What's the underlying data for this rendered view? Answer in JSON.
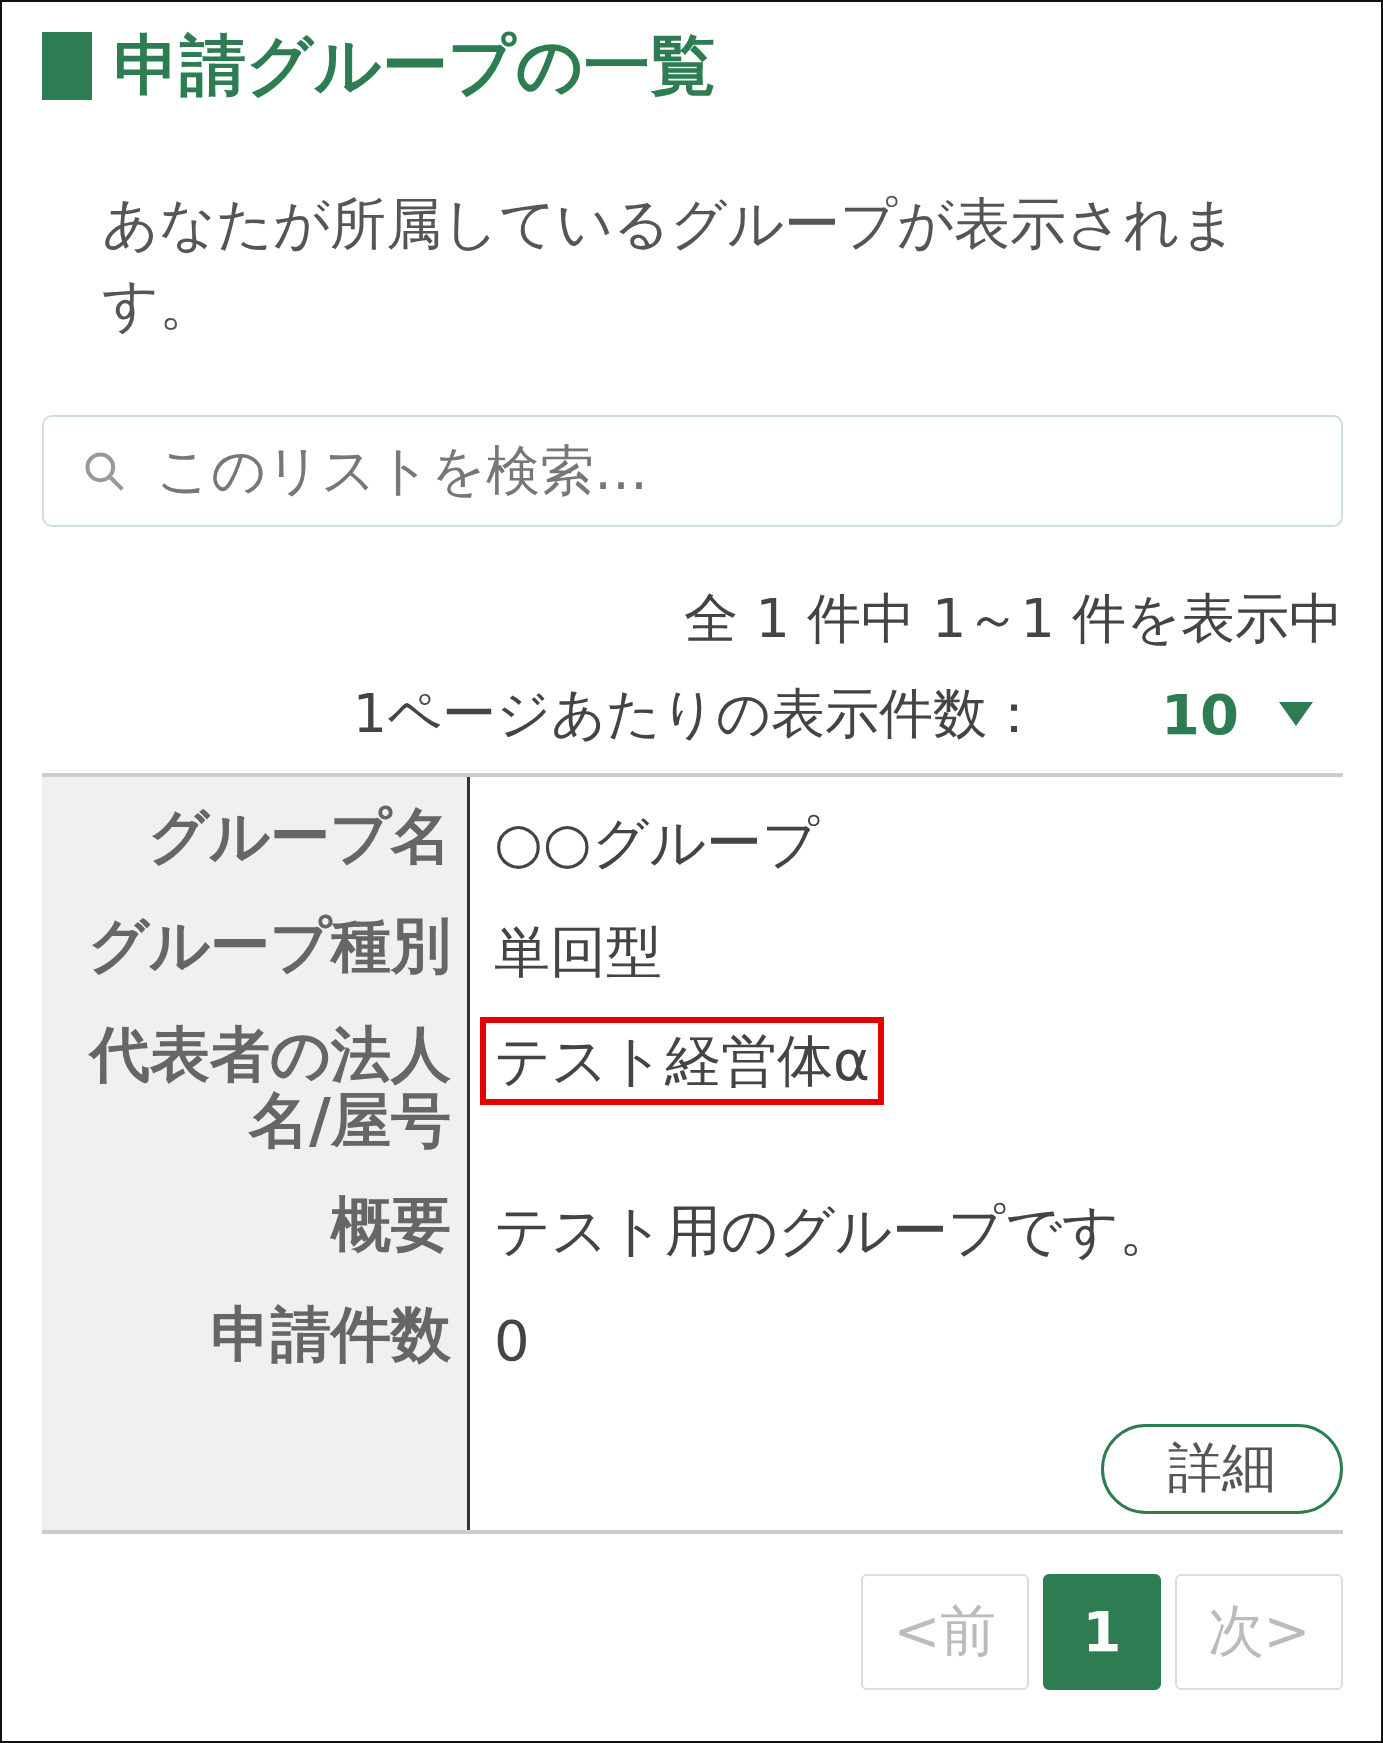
{
  "title": "申請グループの一覧",
  "description": "あなたが所属しているグループが表示されます。",
  "search": {
    "placeholder": "このリストを検索…"
  },
  "summary": "全 1 件中 1～1 件を表示中",
  "per_page": {
    "label": "1ページあたりの表示件数：",
    "value": "10"
  },
  "record": {
    "fields": [
      {
        "label": "グループ名",
        "value": "○○グループ",
        "highlighted": false
      },
      {
        "label": "グループ種別",
        "value": "単回型",
        "highlighted": false
      },
      {
        "label": "代表者の法人名/屋号",
        "value": "テスト経営体α",
        "highlighted": true
      },
      {
        "label": "概要",
        "value": "テスト用のグループです。",
        "highlighted": false
      },
      {
        "label": "申請件数",
        "value": "0",
        "highlighted": false
      }
    ],
    "button": "詳細"
  },
  "pagination": [
    {
      "label": "<前",
      "selected": false,
      "disabled": true
    },
    {
      "label": "1",
      "selected": true,
      "disabled": false
    },
    {
      "label": "次>",
      "selected": false,
      "disabled": true
    }
  ]
}
